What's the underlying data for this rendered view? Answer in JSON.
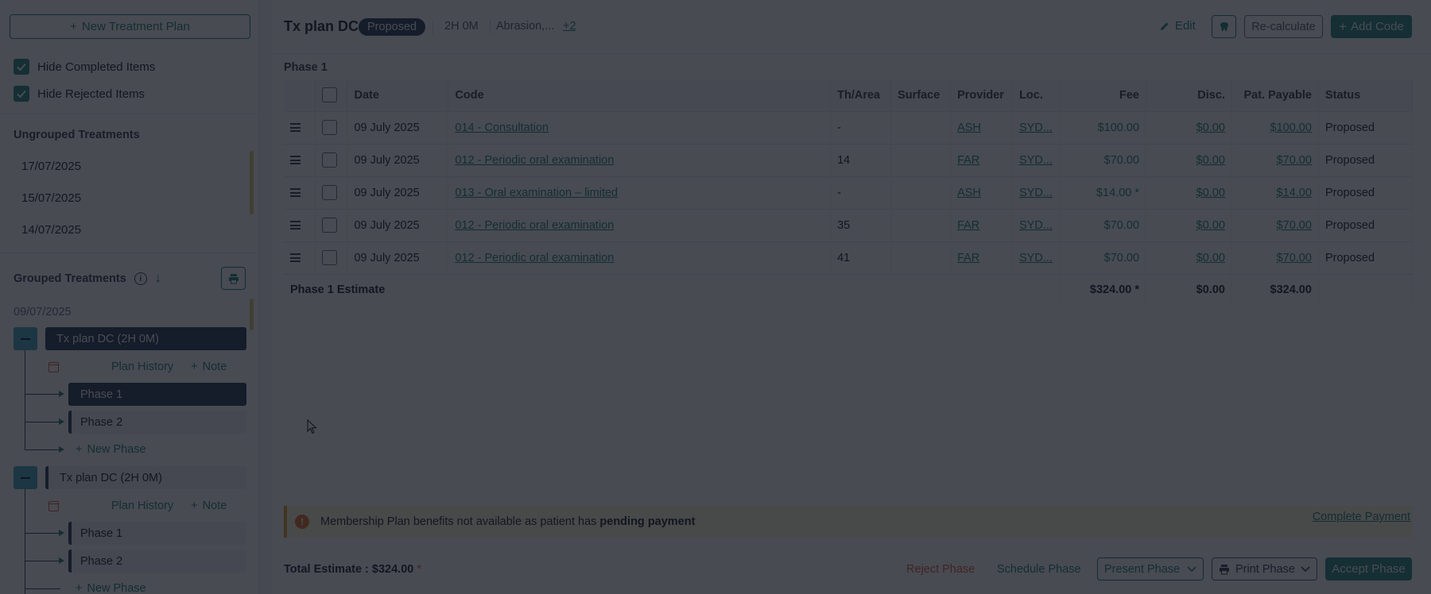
{
  "sidebar": {
    "new_plan_label": "New Treatment Plan",
    "hide_completed": "Hide Completed Items",
    "hide_rejected": "Hide Rejected Items",
    "ungrouped_title": "Ungrouped Treatments",
    "ungrouped_dates": [
      "17/07/2025",
      "15/07/2025",
      "14/07/2025"
    ],
    "grouped_title": "Grouped Treatments",
    "group_date": "09/07/2025",
    "plans": [
      {
        "title": "Tx plan DC (2H 0M)",
        "history": "Plan History",
        "note": "Note",
        "phases": [
          "Phase 1",
          "Phase 2"
        ],
        "new_phase": "New Phase"
      },
      {
        "title": "Tx plan DC (2H 0M)",
        "history": "Plan History",
        "note": "Note",
        "phases": [
          "Phase 1",
          "Phase 2"
        ],
        "new_phase": "New Phase"
      }
    ]
  },
  "header": {
    "title": "Tx plan DC",
    "status": "Proposed",
    "duration": "2H 0M",
    "tags": "Abrasion,...",
    "more": "+2",
    "edit": "Edit",
    "recalc": "Re-calculate",
    "add_code": "Add Code"
  },
  "phase": {
    "label": "Phase 1",
    "columns": [
      "Date",
      "Code",
      "Th/Area",
      "Surface",
      "Provider",
      "Loc.",
      "Fee",
      "Disc.",
      "Pat. Payable",
      "Status"
    ],
    "rows": [
      {
        "date": "09 July 2025",
        "code": "014 - Consultation",
        "area": "-",
        "surface": "",
        "provider": "ASH",
        "loc": "SYD...",
        "fee": "$100.00",
        "disc": "$0.00",
        "payable": "$100.00",
        "status": "Proposed"
      },
      {
        "date": "09 July 2025",
        "code": "012 - Periodic oral examination",
        "area": "14",
        "surface": "",
        "provider": "FAR",
        "loc": "SYD...",
        "fee": "$70.00",
        "disc": "$0.00",
        "payable": "$70.00",
        "status": "Proposed"
      },
      {
        "date": "09 July 2025",
        "code": "013 - Oral examination – limited",
        "area": "-",
        "surface": "",
        "provider": "ASH",
        "loc": "SYD...",
        "fee": "$14.00 *",
        "disc": "$0.00",
        "payable": "$14.00",
        "status": "Proposed"
      },
      {
        "date": "09 July 2025",
        "code": "012 - Periodic oral examination",
        "area": "35",
        "surface": "",
        "provider": "FAR",
        "loc": "SYD...",
        "fee": "$70.00",
        "disc": "$0.00",
        "payable": "$70.00",
        "status": "Proposed"
      },
      {
        "date": "09 July 2025",
        "code": "012 - Periodic oral examination",
        "area": "41",
        "surface": "",
        "provider": "FAR",
        "loc": "SYD...",
        "fee": "$70.00",
        "disc": "$0.00",
        "payable": "$70.00",
        "status": "Proposed"
      }
    ],
    "estimate_label": "Phase 1 Estimate",
    "estimate_fee": "$324.00 *",
    "estimate_disc": "$0.00",
    "estimate_payable": "$324.00"
  },
  "alert": {
    "text": "Membership Plan benefits not available as patient has ",
    "bold": "pending payment",
    "link": "Complete Payment"
  },
  "footer": {
    "total": "Total Estimate : $324.00",
    "asterisk": "*",
    "reject": "Reject Phase",
    "schedule": "Schedule Phase",
    "present": "Present Phase",
    "print": "Print Phase",
    "accept": "Accept Phase"
  },
  "colors": {
    "accent": "#2b8a84",
    "navy": "#2a3a5a",
    "danger": "#e05a3c",
    "warning": "#e7a12a"
  }
}
